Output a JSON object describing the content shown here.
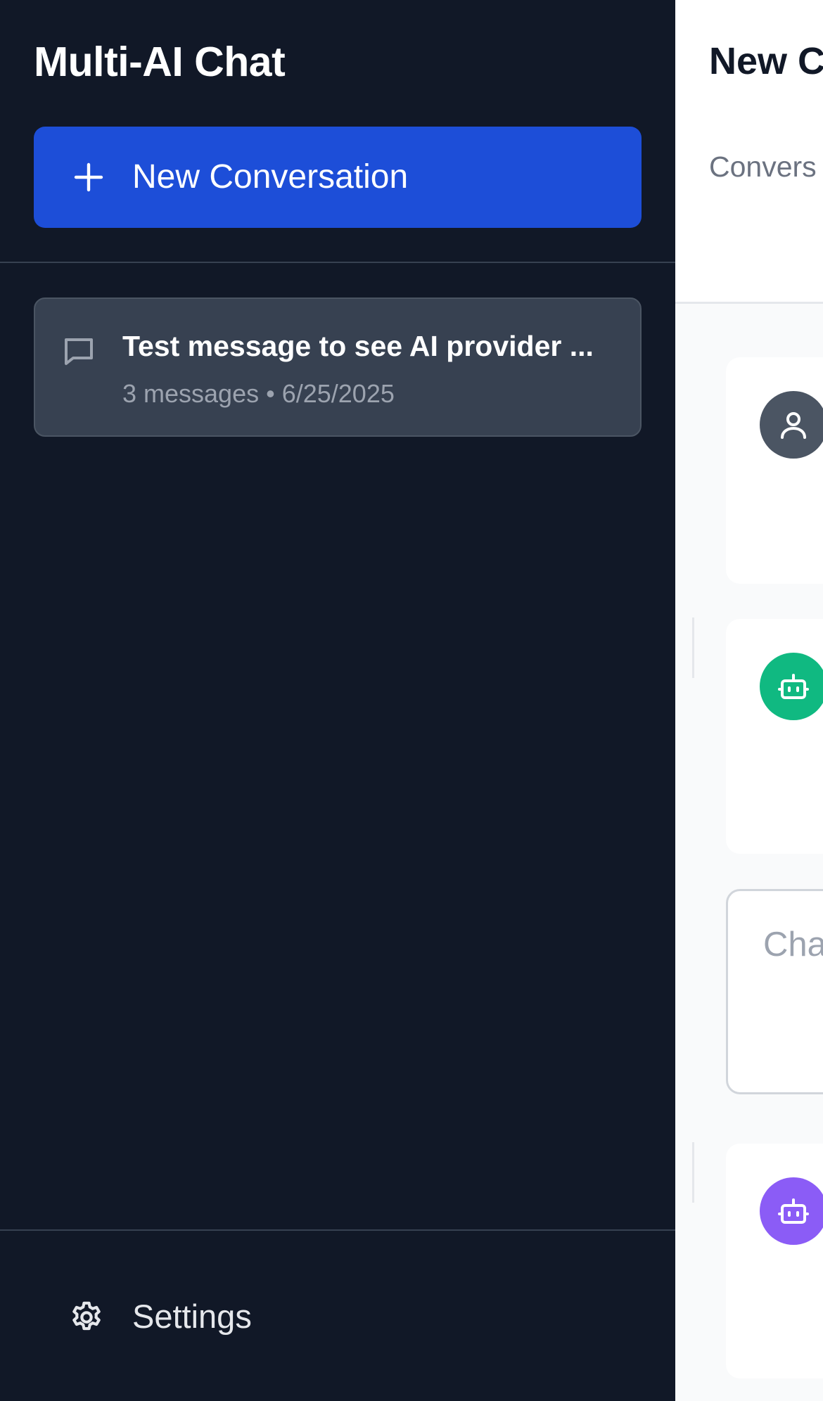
{
  "sidebar": {
    "app_title": "Multi-AI Chat",
    "new_conversation_label": "New Conversation",
    "conversations": [
      {
        "title": "Test message to see AI provider ...",
        "meta": "3 messages • 6/25/2025"
      }
    ],
    "settings_label": "Settings",
    "icons": {
      "new": "plus-icon",
      "conversation": "chat-bubble-icon",
      "settings": "gear-icon"
    }
  },
  "main": {
    "title": "New C",
    "subtitle": "Convers Tree",
    "input_placeholder": "Cha prov",
    "avatars": [
      {
        "role": "user",
        "icon": "user-icon",
        "color": "#4b5563"
      },
      {
        "role": "assistant",
        "icon": "bot-icon",
        "color": "#10b981"
      },
      {
        "role": "assistant",
        "icon": "bot-icon",
        "color": "#8b5cf6"
      }
    ]
  },
  "colors": {
    "sidebar_bg": "#111827",
    "accent": "#1d4ed8",
    "conversation_item_bg": "#374151"
  }
}
